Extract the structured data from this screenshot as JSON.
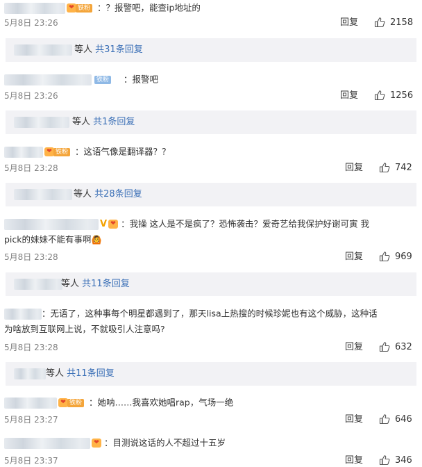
{
  "comments": [
    {
      "text": "：？报警吧，能查ip地址的",
      "badge": "铁粉",
      "time": "5月8日 23:26",
      "reply": "回复",
      "likes": "2158",
      "sub": {
        "dengren": "等人",
        "total": "共31条回复"
      }
    },
    {
      "text": "：报警吧",
      "badge": "铁粉",
      "time": "5月8日 23:26",
      "reply": "回复",
      "likes": "1256",
      "sub": {
        "dengren": "等人",
        "total": "共1条回复"
      }
    },
    {
      "text": "：这语气像是翻译器？？",
      "badge": "铁粉",
      "time": "5月8日 23:28",
      "reply": "回复",
      "likes": "742",
      "sub": {
        "dengren": "等人",
        "total": "共28条回复"
      }
    },
    {
      "vip": "V",
      "text": "：我操 这人是不是疯了？恐怖袭击？爱奇艺给我保护好谢可寅 我",
      "text2": "pick的妹妹不能有事啊",
      "emoji": "🙆",
      "time": "5月8日 23:28",
      "reply": "回复",
      "likes": "969",
      "sub": {
        "dengren": "等人",
        "total": "共11条回复"
      }
    },
    {
      "text": "：无语了，这种事每个明星都遇到了，那天lisa上热搜的时候珍妮也有这个威胁，这种话",
      "text2": "为啥放到互联网上说，不就吸引人注意吗?",
      "time": "5月8日 23:28",
      "reply": "回复",
      "likes": "632",
      "sub": {
        "dengren": "等人",
        "total": "共11条回复"
      }
    },
    {
      "text": "：她呐……我喜欢她唱rap，气场一绝",
      "badge": "铁粉",
      "time": "5月8日 23:27",
      "reply": "回复",
      "likes": "646"
    },
    {
      "text": "：目测说这话的人不超过十五岁",
      "time": "5月8日 23:37",
      "reply": "回复",
      "likes": "346"
    }
  ],
  "icons": {
    "like": "thumbs-up-icon",
    "heart": "fan-heart-icon"
  },
  "colors": {
    "link": "#3a6fb6",
    "subreply_bg": "#f2f2f5",
    "badge": "#f4a53a",
    "vip": "#f2a100",
    "time": "#808080"
  }
}
